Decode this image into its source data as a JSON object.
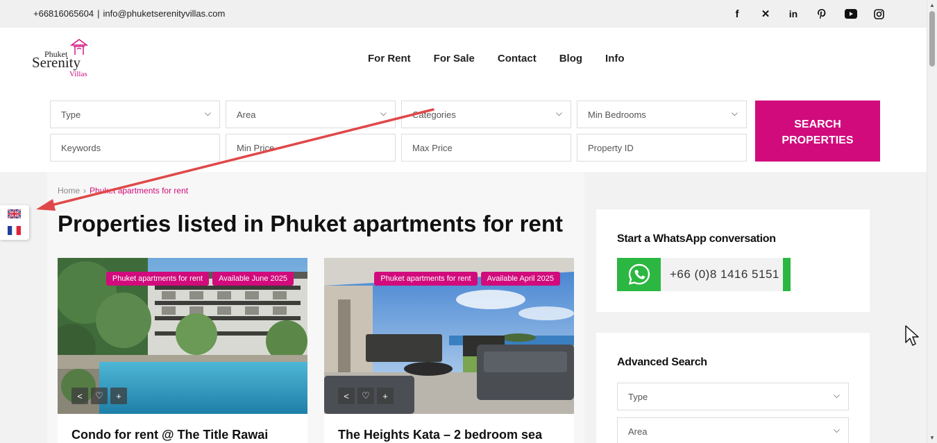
{
  "topbar": {
    "phone": "+66816065604",
    "separator": "|",
    "email": "info@phuketserenityvillas.com",
    "social_icons": [
      "facebook-icon",
      "x-icon",
      "linkedin-icon",
      "pinterest-icon",
      "youtube-icon",
      "instagram-icon"
    ]
  },
  "logo": {
    "line1": "Phuket",
    "line2": "Serenity",
    "line3": "Villas"
  },
  "nav": [
    "For Rent",
    "For Sale",
    "Contact",
    "Blog",
    "Info"
  ],
  "search": {
    "type": "Type",
    "area": "Area",
    "categories": "Categories",
    "min_bedrooms": "Min Bedrooms",
    "keywords": "Keywords",
    "min_price": "Min Price",
    "max_price": "Max Price",
    "property_id": "Property ID",
    "button_line1": "SEARCH",
    "button_line2": "PROPERTIES"
  },
  "breadcrumb": {
    "home": "Home",
    "current": "Phuket apartments for rent"
  },
  "page_title": "Properties listed in Phuket apartments for rent",
  "listings": [
    {
      "category": "Phuket apartments for rent",
      "availability": "Available June 2025",
      "title": "Condo for rent @ The Title Rawai"
    },
    {
      "category": "Phuket apartments for rent",
      "availability": "Available April 2025",
      "title": "The Heights Kata – 2 bedroom sea"
    }
  ],
  "whatsapp": {
    "heading": "Start a WhatsApp conversation",
    "number": "+66 (0)8 1416 5151"
  },
  "advanced_search": {
    "heading": "Advanced Search",
    "type": "Type",
    "area": "Area"
  },
  "colors": {
    "accent": "#d10b7c",
    "whatsapp": "#2bb741",
    "annotation_arrow": "#e04848"
  }
}
